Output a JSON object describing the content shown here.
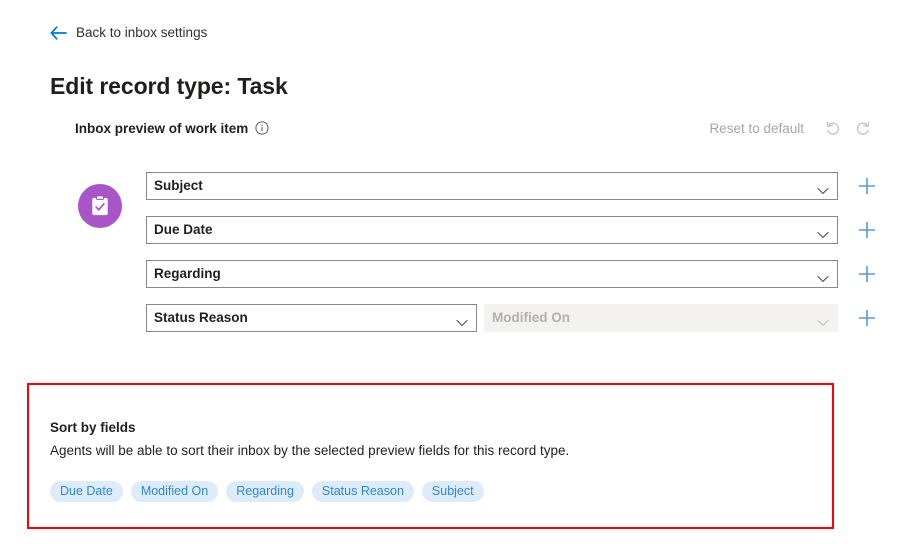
{
  "back_link": {
    "label": "Back to inbox settings",
    "icon": "arrow-left-icon"
  },
  "page_title": "Edit record type: Task",
  "section": {
    "title": "Inbox preview of work item",
    "info_icon": "info-icon",
    "reset_label": "Reset to default",
    "undo_icon": "undo-icon",
    "redo_icon": "redo-icon"
  },
  "record_avatar": {
    "icon": "task-clipboard-icon",
    "color": "#a855c8"
  },
  "preview_rows": [
    {
      "primary": {
        "value": "Subject",
        "disabled": false
      },
      "secondary": null,
      "add_icon": "plus-icon"
    },
    {
      "primary": {
        "value": "Due Date",
        "disabled": false
      },
      "secondary": null,
      "add_icon": "plus-icon"
    },
    {
      "primary": {
        "value": "Regarding",
        "disabled": false
      },
      "secondary": null,
      "add_icon": "plus-icon"
    },
    {
      "primary": {
        "value": "Status Reason",
        "disabled": false
      },
      "secondary": {
        "value": "Modified On",
        "disabled": true
      },
      "add_icon": "plus-icon"
    }
  ],
  "sort_section": {
    "title": "Sort by fields",
    "description": "Agents will be able to sort their inbox by the selected preview fields for this record type.",
    "chips": [
      "Due Date",
      "Modified On",
      "Regarding",
      "Status Reason",
      "Subject"
    ]
  },
  "annotation": {
    "color": "#ff0000"
  },
  "colors": {
    "accent_blue": "#2b88d8",
    "link_blue": "#0078d4",
    "chip_bg": "#deecf9",
    "avatar_purple": "#a855c8",
    "disabled_bg": "#f3f2f1",
    "disabled_text": "#b3b0ad",
    "border_grey": "#8a8886"
  }
}
